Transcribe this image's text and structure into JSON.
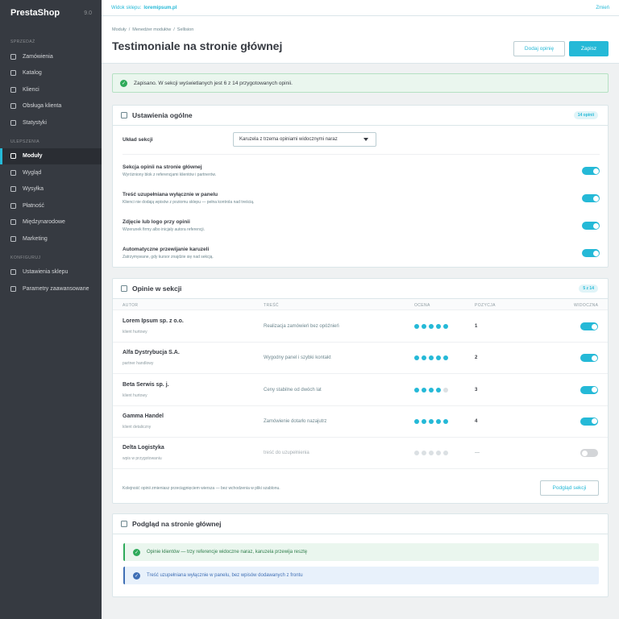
{
  "sidebar": {
    "brand": "PrestaShop",
    "version": "9.0",
    "sections": [
      {
        "title": "SPRZEDAŻ",
        "items": [
          "Zamówienia",
          "Katalog",
          "Klienci",
          "Obsługa klienta",
          "Statystyki"
        ]
      },
      {
        "title": "ULEPSZENIA",
        "items": [
          "Moduły",
          "Wygląd",
          "Wysyłka",
          "Płatność",
          "Międzynarodowe",
          "Marketing"
        ]
      },
      {
        "title": "KONFIGURUJ",
        "items": [
          "Ustawienia sklepu",
          "Parametry zaawansowane"
        ]
      }
    ],
    "active": "Moduły"
  },
  "topbar": {
    "shop_label": "Widok sklepu:",
    "shop_name": "loremipsum.pl",
    "change": "Zmień"
  },
  "header": {
    "breadcrumb": [
      "Moduły",
      "/",
      "Menedżer modułów",
      "/",
      "Sellision"
    ],
    "title": "Testimoniale na stronie głównej",
    "add_button": "Dodaj opinię",
    "save_button": "Zapisz"
  },
  "alert": {
    "text": "Zapisano. W sekcji wyświetlanych jest 6 z 14 przygotowanych opinii."
  },
  "general": {
    "title": "Ustawienia ogólne",
    "badge": "14 opinii",
    "layout_label": "Układ sekcji",
    "layout_value": "Karuzela z trzema opiniami widocznymi naraz",
    "settings": [
      {
        "title": "Sekcja opinii na stronie głównej",
        "desc": "Wyróżniony blok z referencjami klientów i partnerów.",
        "on": true
      },
      {
        "title": "Treść uzupełniana wyłącznie w panelu",
        "desc": "Klienci nie dodają wpisów z poziomu sklepu — pełna kontrola nad treścią.",
        "on": true
      },
      {
        "title": "Zdjęcie lub logo przy opinii",
        "desc": "Wizerunek firmy albo inicjały autora referencji.",
        "on": true
      },
      {
        "title": "Automatyczne przewijanie karuzeli",
        "desc": "Zatrzymywane, gdy kursor znajdzie się nad sekcją.",
        "on": true
      }
    ]
  },
  "reviews": {
    "title": "Opinie w sekcji",
    "badge": "5 z 14",
    "columns": {
      "author": "AUTOR",
      "content": "TREŚĆ",
      "rating": "OCENA",
      "position": "POZYCJA",
      "visible": "WIDOCZNA"
    },
    "rows": [
      {
        "author": "Lorem Ipsum sp. z o.o.",
        "role": "klient hurtowy",
        "content": "Realizacja zamówień bez opóźnień",
        "rating": 5,
        "position": "1",
        "visible": true
      },
      {
        "author": "Alfa Dystrybucja S.A.",
        "role": "partner handlowy",
        "content": "Wygodny panel i szybki kontakt",
        "rating": 5,
        "position": "2",
        "visible": true
      },
      {
        "author": "Beta Serwis sp. j.",
        "role": "klient hurtowy",
        "content": "Ceny stabilne od dwóch lat",
        "rating": 4,
        "position": "3",
        "visible": true
      },
      {
        "author": "Gamma Handel",
        "role": "klient detaliczny",
        "content": "Zamówienie dotarło nazajutrz",
        "rating": 5,
        "position": "4",
        "visible": true
      },
      {
        "author": "Delta Logistyka",
        "role": "wpis w przygotowaniu",
        "content": "treść do uzupełnienia",
        "rating": 0,
        "position": "—",
        "visible": false
      }
    ],
    "footer_note": "Kolejność opinii zmieniasz przeciągnięciem wiersza — bez wchodzenia w pliki szablonu.",
    "preview_button": "Podgląd sekcji"
  },
  "preview": {
    "title": "Podgląd na stronie głównej",
    "notes": [
      "Opinie klientów — trzy referencje widoczne naraz, karuzela przewija resztę",
      "Treść uzupełniana wyłącznie w panelu, bez wpisów dodawanych z frontu"
    ]
  },
  "colors": {
    "accent": "#25b9d7",
    "sidebar": "#363a41",
    "success": "#2eaa5a",
    "info": "#3f6fb5"
  }
}
